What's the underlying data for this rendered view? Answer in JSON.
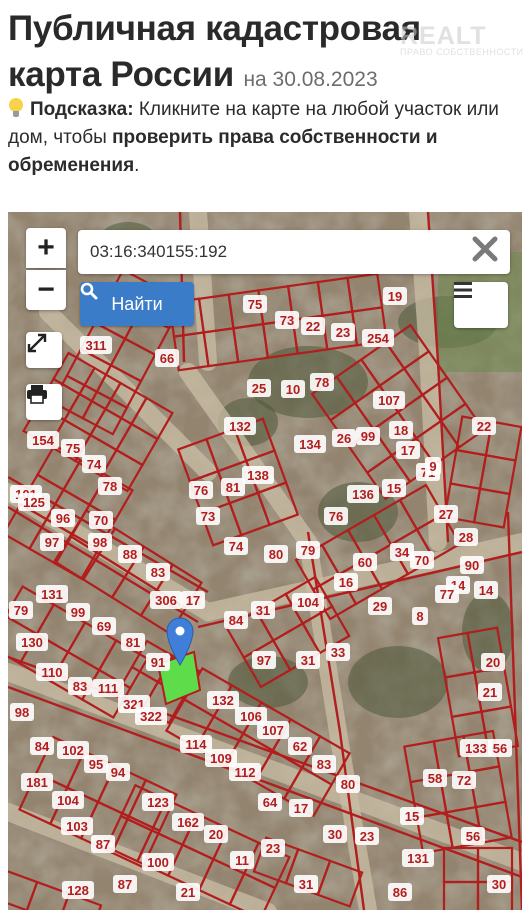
{
  "header": {
    "title": "Публичная кадастровая карта России",
    "date": "на 30.08.2023",
    "watermark": "REALT",
    "watermark_sub": "ПРАВО СОБСТВЕННОСТИ"
  },
  "hint": {
    "icon": "lightbulb-icon",
    "label": "Подсказка:",
    "text": "Кликните на карте на любой участок или дом, чтобы",
    "bold_text": "проверить права собственности и обременения",
    "end": "."
  },
  "map": {
    "zoom_in": "+",
    "zoom_out": "−",
    "search_value": "03:16:340155:192",
    "search_button": "Найти",
    "colors": {
      "boundary": "#b21d1d",
      "highlight": "#5fdc4a",
      "pin": "#3f7fd9",
      "label_bg": "#ffffff"
    },
    "parcel_labels": [
      "75",
      "73",
      "22",
      "23",
      "254",
      "19",
      "311",
      "66",
      "25",
      "10",
      "78",
      "107",
      "18",
      "132",
      "22",
      "134",
      "26",
      "99",
      "17",
      "71",
      "9",
      "154",
      "75",
      "74",
      "76",
      "81",
      "138",
      "136",
      "15",
      "101",
      "125",
      "96",
      "70",
      "78",
      "73",
      "76",
      "27",
      "97",
      "98",
      "88",
      "74",
      "80",
      "79",
      "28",
      "14",
      "83",
      "60",
      "34",
      "70",
      "90",
      "131",
      "99",
      "306",
      "84",
      "31",
      "104",
      "16",
      "29",
      "8",
      "77",
      "14",
      "79",
      "130",
      "69",
      "81",
      "91",
      "17",
      "31",
      "33",
      "97",
      "20",
      "110",
      "83",
      "111",
      "321",
      "322",
      "132",
      "106",
      "107",
      "21",
      "98",
      "114",
      "62",
      "133",
      "56",
      "84",
      "102",
      "95",
      "109",
      "112",
      "94",
      "83",
      "80",
      "58",
      "72",
      "181",
      "104",
      "123",
      "64",
      "17",
      "103",
      "162",
      "20",
      "30",
      "23",
      "15",
      "131",
      "56",
      "87",
      "100",
      "11",
      "23",
      "128",
      "21",
      "87",
      "86",
      "30",
      "31"
    ]
  }
}
